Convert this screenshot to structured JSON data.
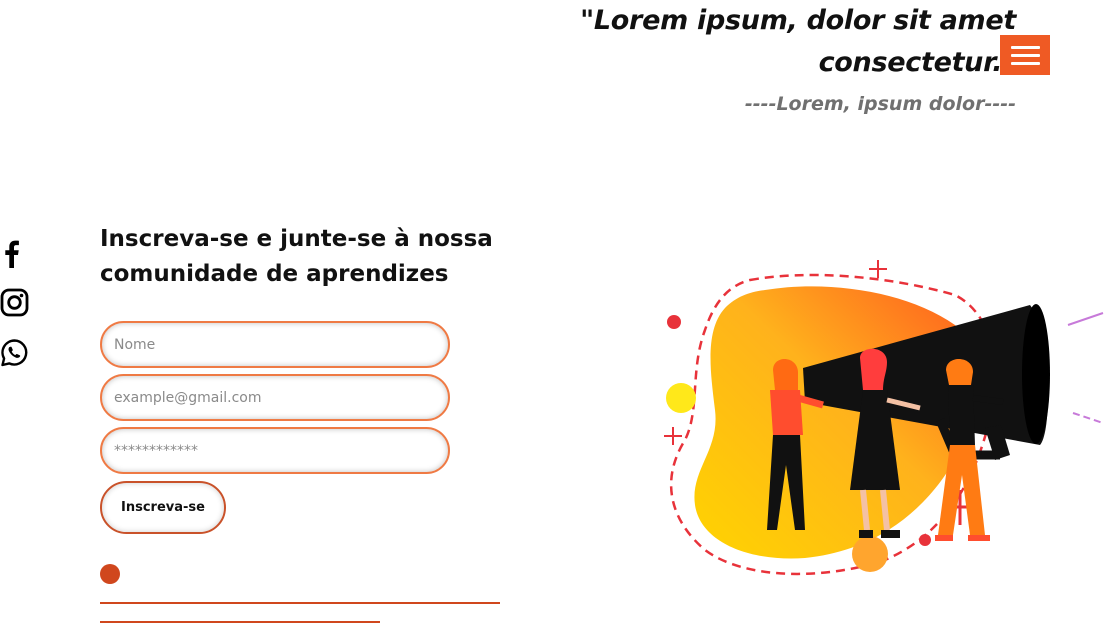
{
  "hero": {
    "quote": "\"Lorem ipsum, dolor sit amet consectetur.\"",
    "author": "----Lorem, ipsum dolor----"
  },
  "nav": {
    "menu_icon": "hamburger-menu-icon",
    "accent": "#ef5a24"
  },
  "social": [
    {
      "icon": "facebook-icon"
    },
    {
      "icon": "instagram-icon"
    },
    {
      "icon": "whatsapp-icon"
    }
  ],
  "signup": {
    "heading": "Inscreva-se e junte-se à nossa comunidade de aprendizes",
    "name_placeholder": "Nome",
    "email_placeholder": "example@gmail.com",
    "password_placeholder": "************",
    "submit_label": "Inscreva-se",
    "border_color": "#ef7a44",
    "accent": "#d0471d"
  },
  "illustration": {
    "icon": "megaphone-team-illustration"
  }
}
